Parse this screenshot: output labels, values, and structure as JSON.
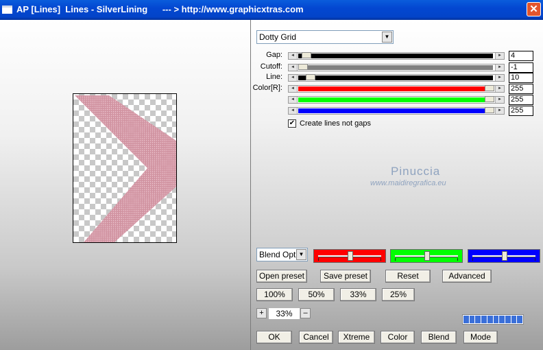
{
  "window": {
    "title": "AP [Lines]  Lines - SilverLining      --- > http://www.graphicxtras.com",
    "close_glyph": "✕"
  },
  "effect_select": {
    "value": "Dotty Grid"
  },
  "params": [
    {
      "label": "Gap:",
      "value": "4",
      "fill_color": "#000000",
      "level": 0.02
    },
    {
      "label": "Cutoff:",
      "value": "-1",
      "fill_color": "#808080",
      "level": 0.0
    },
    {
      "label": "Line:",
      "value": "10",
      "fill_color": "#000000",
      "level": 0.04
    },
    {
      "label": "Color[R]:",
      "value": "255",
      "fill_color": "#ff0000",
      "level": 1.0
    },
    {
      "label": "",
      "value": "255",
      "fill_color": "#00ff00",
      "level": 1.0
    },
    {
      "label": "",
      "value": "255",
      "fill_color": "#0000ff",
      "level": 1.0
    }
  ],
  "checkbox": {
    "label": "Create lines not gaps",
    "checked": true,
    "mark": "✔"
  },
  "watermark": {
    "name": "Pinuccia",
    "url": "www.maidiregrafica.eu"
  },
  "blend_select": {
    "value": "Blend Optio"
  },
  "color_sliders": [
    {
      "color": "#ff0000",
      "level": 0.5
    },
    {
      "color": "#00ff00",
      "level": 0.5
    },
    {
      "color": "#0000ff",
      "level": 0.5
    }
  ],
  "buttons_row1": [
    "Open preset",
    "Save preset",
    "Reset",
    "Advanced"
  ],
  "zoom_buttons": [
    "100%",
    "50%",
    "33%",
    "25%"
  ],
  "zoom": {
    "plus": "+",
    "value": "33%",
    "minus": "–"
  },
  "bottom_buttons": [
    "OK",
    "Cancel",
    "Xtreme",
    "Color",
    "Blend",
    "Mode"
  ],
  "progress_blocks": 10
}
